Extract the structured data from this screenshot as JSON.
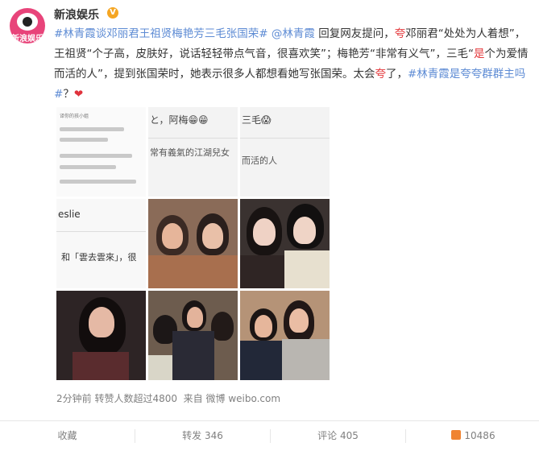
{
  "account": {
    "name": "新浪娱乐",
    "avatar_text": "新浪娱乐"
  },
  "post": {
    "hashtag1": "#林青霞谈邓丽君王祖贤梅艳芳三毛张国荣#",
    "mention": "@林青霞",
    "p1": " 回复网友提问，",
    "kua1": "夸",
    "p2": "邓丽君“处处为人着想”，王祖贤“个子高，皮肤好，说话轻轻带点气音，很喜欢笑”；梅艳芳“非常有义气”，三毛“",
    "shi": "是",
    "p3": "个为爱情而活的人”，提到张国荣时，她表示很多人都想看她写张国荣。太会",
    "kua2": "夸",
    "p4": "了，",
    "hashtag2": "#林青霞是夸夸群群主吗#",
    "p5": "？",
    "heart": "❤"
  },
  "tiles": {
    "t1": {
      "line1": "译你的孩小姐",
      "line2": "常有義氣的江湖兒女"
    },
    "t2": {
      "text": "と，阿梅😁😁",
      "text2": "常有義氣的江湖兒女"
    },
    "t3": {
      "text": "三毛😱",
      "text2": "而活的人"
    },
    "t4": {
      "text": "eslie",
      "text2": "和「雲去雲來」，很"
    }
  },
  "meta": {
    "time": "2分钟前",
    "reposts_note": "转赞人数超过4800",
    "source_prefix": "来自",
    "source": "微博 weibo.com"
  },
  "actions": {
    "favorite": "收藏",
    "repost": "转发 346",
    "comment": "评论 405",
    "like_count": "10486"
  }
}
